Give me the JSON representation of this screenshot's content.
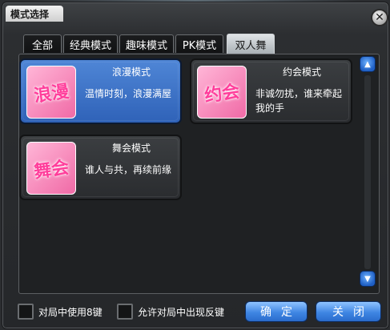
{
  "window": {
    "title": "模式选择"
  },
  "tabs": [
    {
      "label": "全部",
      "active": false
    },
    {
      "label": "经典模式",
      "active": false
    },
    {
      "label": "趣味模式",
      "active": false
    },
    {
      "label": "PK模式",
      "active": false
    },
    {
      "label": "双人舞",
      "active": true
    }
  ],
  "modes": [
    {
      "name": "浪漫模式",
      "description": "温情时刻，浪漫满屋",
      "badge": "浪漫",
      "selected": true
    },
    {
      "name": "约会模式",
      "description": "非诚勿扰，谁来牵起我的手",
      "badge": "约会",
      "selected": false
    },
    {
      "name": "舞会模式",
      "description": "谁人与共，再续前缘",
      "badge": "舞会",
      "selected": false
    }
  ],
  "options": [
    {
      "label": "对局中使用8键",
      "checked": false
    },
    {
      "label": "允许对局中出现反键",
      "checked": false
    }
  ],
  "buttons": {
    "confirm": "确定",
    "close": "关闭"
  },
  "icons": {
    "close": "close-icon",
    "scroll_up": "arrow-up-icon",
    "scroll_down": "arrow-down-icon"
  },
  "colors": {
    "accent": "#3f86e3",
    "selected_card": "#2f62b8",
    "badge_pink": "#f06aa6"
  }
}
